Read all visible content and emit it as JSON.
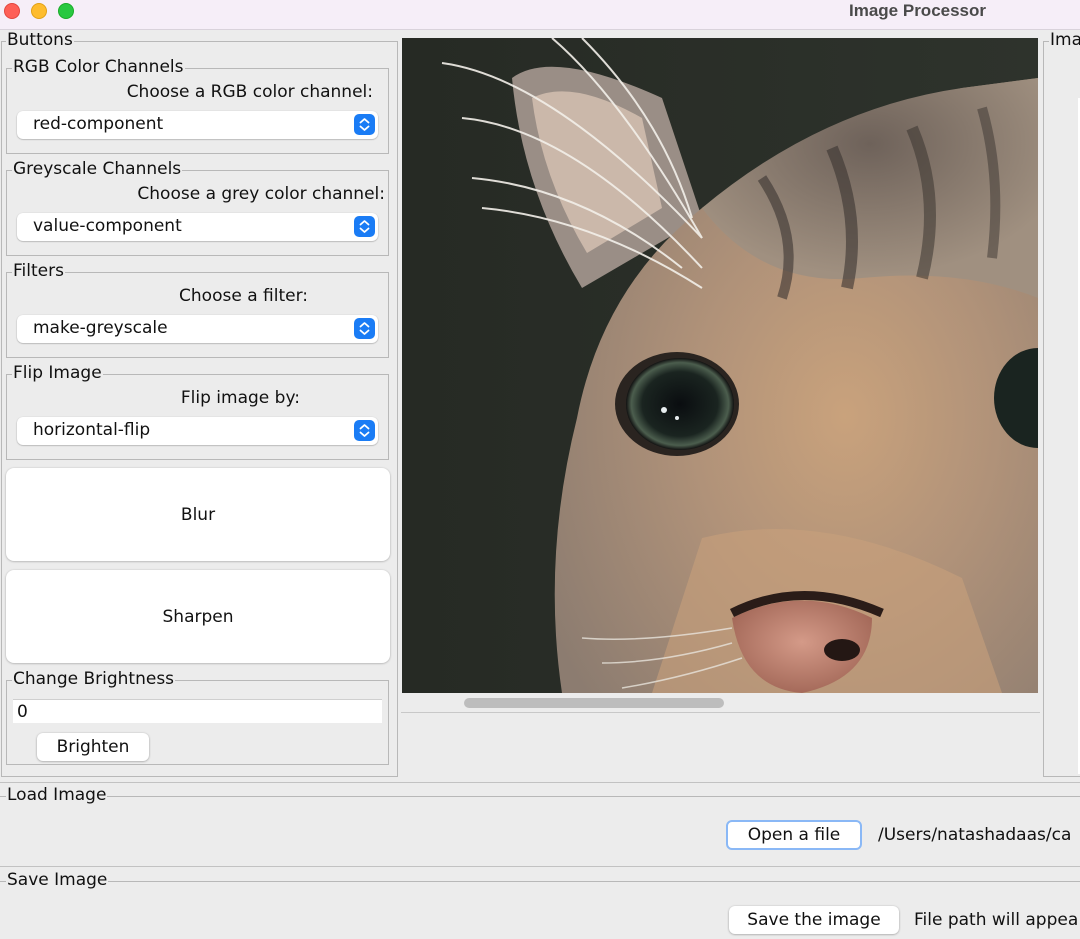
{
  "window": {
    "title": "Image Processor"
  },
  "panels": {
    "buttons_legend": "Buttons",
    "histogram_legend": "Ima"
  },
  "rgb": {
    "legend": "RGB Color Channels",
    "prompt": "Choose a RGB color channel:",
    "selected": "red-component"
  },
  "grey": {
    "legend": "Greyscale Channels",
    "prompt": "Choose a grey color channel:",
    "selected": "value-component"
  },
  "filters": {
    "legend": "Filters",
    "prompt": "Choose a filter:",
    "selected": "make-greyscale"
  },
  "flip": {
    "legend": "Flip Image",
    "prompt": "Flip image by:",
    "selected": "horizontal-flip"
  },
  "actions": {
    "blur_label": "Blur",
    "sharpen_label": "Sharpen"
  },
  "brightness": {
    "legend": "Change Brightness",
    "value": "0",
    "button_label": "Brighten"
  },
  "load": {
    "legend": "Load Image",
    "button_label": "Open a file",
    "path": "/Users/natashadaas/ca"
  },
  "save": {
    "legend": "Save Image",
    "button_label": "Save the image",
    "path": "File path will appea"
  },
  "image": {
    "subject": "close-up of a tabby cat's face"
  },
  "colors": {
    "window_bg": "#ececec",
    "titlebar_bg": "#f6eef8",
    "accent": "#1a7cf5",
    "focus_ring": "#8ab8f6"
  },
  "icons": {
    "close": "close-icon",
    "minimize": "minimize-icon",
    "zoom": "zoom-icon",
    "dropdown": "chevron-updown-icon"
  }
}
